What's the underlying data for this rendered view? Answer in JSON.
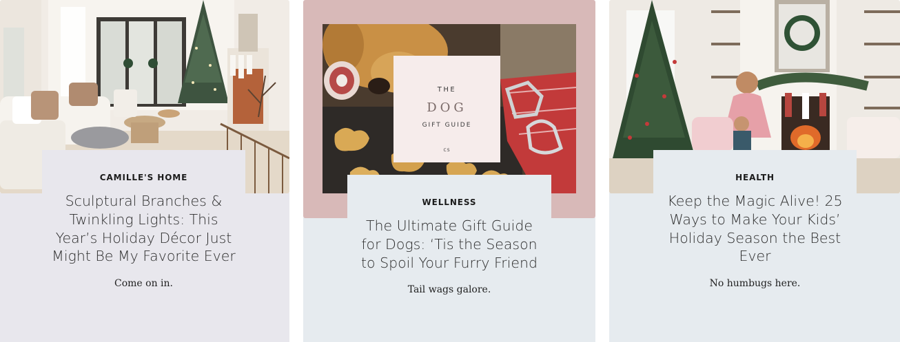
{
  "cards": [
    {
      "category": "CAMILLE'S HOME",
      "title": "Sculptural Branches & Twinkling Lights: This Year’s Holiday Décor Just Might Be My Favorite Ever",
      "tagline": "Come on in."
    },
    {
      "category": "WELLNESS",
      "title": "The Ultimate Gift Guide for Dogs: ‘Tis the Season to Spoil Your Furry Friend",
      "tagline": "Tail wags galore.",
      "image_text": {
        "line1": "THE",
        "line2": "DOG",
        "line3": "GIFT GUIDE",
        "line4": "CS"
      }
    },
    {
      "category": "HEALTH",
      "title": "Keep the Magic Alive! 25 Ways to Make Your Kids’ Holiday Season the Best Ever",
      "tagline": "No humbugs here."
    }
  ],
  "colors": {
    "panel_lavender": "#e8e7ed",
    "panel_blue": "#e6ebef",
    "pink_frame": "#d8b9b8"
  }
}
